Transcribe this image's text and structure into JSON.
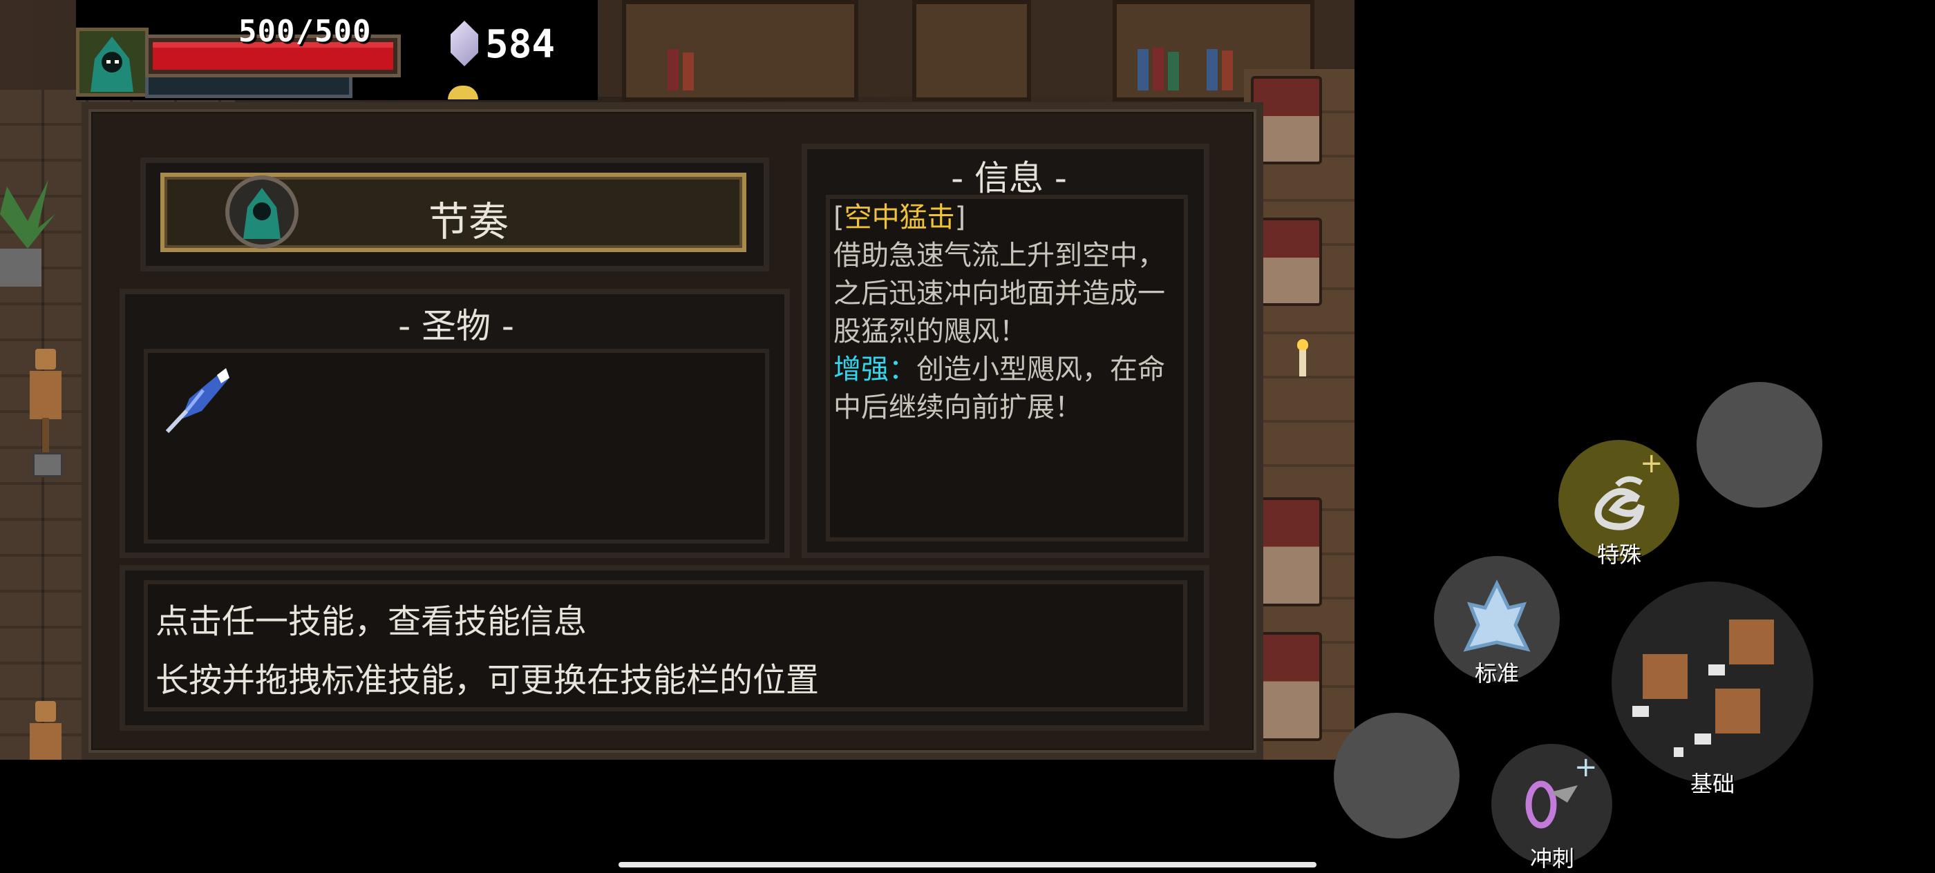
{
  "hud": {
    "hp_text": "500/500",
    "hp_fraction": 1.0,
    "gems": "584"
  },
  "panel": {
    "character_name": "节奏",
    "relic_title": "- 圣物 -",
    "relics": [
      {
        "icon": "blue-feather-icon"
      }
    ],
    "info_title": "- 信息 -",
    "info": {
      "bracket_open": "[",
      "skill_name": "空中猛击",
      "bracket_close": "]",
      "description": "借助急速气流上升到空中，之后迅速冲向地面并造成一股猛烈的飓风！",
      "boost_label": "增强：",
      "boost_text": "创造小型飓风，在命中后继续向前扩展！"
    },
    "hints": [
      "点击任一技能，查看技能信息",
      "长按并拖拽标准技能，可更换在技能栏的位置"
    ]
  },
  "controls": {
    "special_label": "特殊",
    "standard_label": "标准",
    "basic_label": "基础",
    "dash_label": "冲刺",
    "plus": "+"
  },
  "colors": {
    "skill_name": "#f0c33c",
    "boost": "#32d6ef",
    "hp": "#c8141e",
    "special_bg": "#5a5516"
  }
}
